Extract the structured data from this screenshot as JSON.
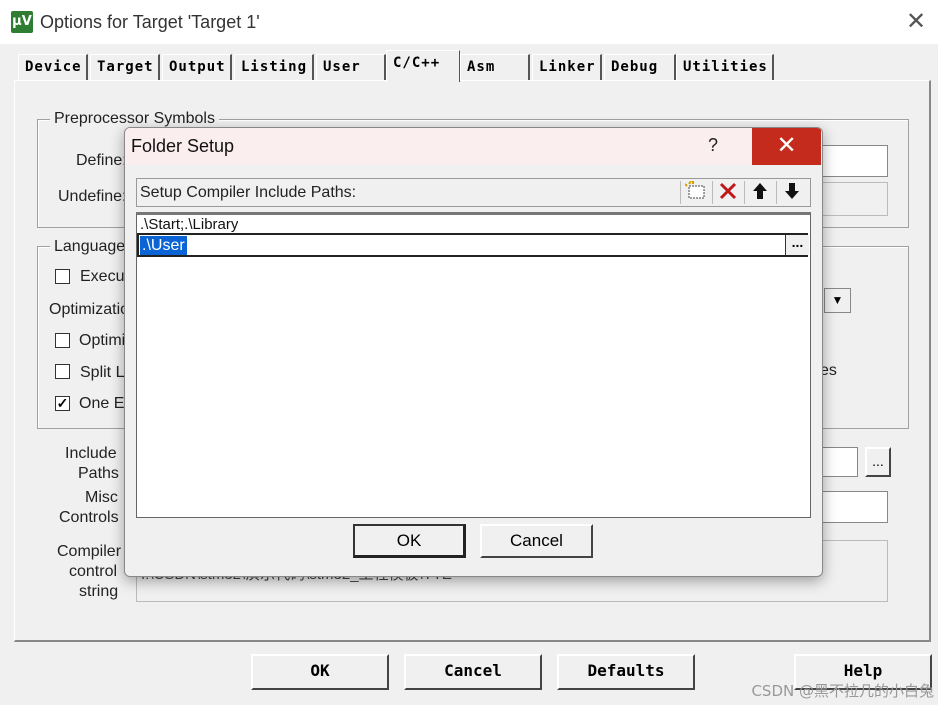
{
  "window": {
    "title": "Options for Target 'Target 1'",
    "close": "✕",
    "icon": "µV"
  },
  "tabs": [
    "Device",
    "Target",
    "Output",
    "Listing",
    "User",
    "C/C++",
    "Asm",
    "Linker",
    "Debug",
    "Utilities"
  ],
  "active_tab": "C/C++",
  "preprocessor": {
    "group_title": "Preprocessor Symbols",
    "define_label": "Define:",
    "undefine_label": "Undefine:"
  },
  "language": {
    "group_title": "Language",
    "execute": "Execu",
    "optimization_label": "Optimizatio",
    "optimize": "Optimi",
    "split": "Split L",
    "one": "One E",
    "right_text": "es"
  },
  "include": {
    "label_line1": "Include",
    "label_line2": "Paths",
    "browse": "..."
  },
  "misc": {
    "label_line1": "Misc",
    "label_line2": "Controls"
  },
  "compiler": {
    "label_line1": "Compiler",
    "label_line2": "control",
    "label_line3": "string",
    "value": "I:\\CSDN\\stm32\\演示代码\\stm32_工程模板\\YTE"
  },
  "bottom_buttons": {
    "ok": "OK",
    "cancel": "Cancel",
    "defaults": "Defaults",
    "help": "Help"
  },
  "dialog": {
    "title": "Folder Setup",
    "help": "?",
    "close": "✕",
    "header_label": "Setup Compiler Include Paths:",
    "toolbar_icons": [
      "new-folder-icon",
      "delete-icon",
      "move-up-icon",
      "move-down-icon"
    ],
    "paths": [
      ".\\Start;.\\Library",
      ".\\User"
    ],
    "browse": "...",
    "ok": "OK",
    "cancel": "Cancel"
  },
  "watermark": "CSDN @黑不拉几的小白兔"
}
